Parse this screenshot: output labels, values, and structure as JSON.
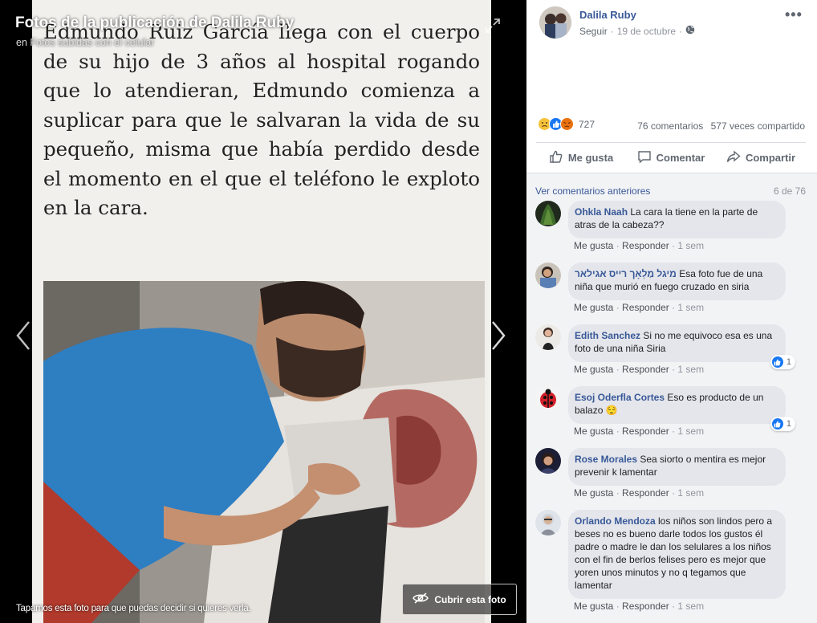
{
  "viewer": {
    "title": "Fotos de la publicación de Dalila Ruby",
    "subtitle": "en Fotos subidas con el celular",
    "photo_text": "Edmundo Ruiz García llega con el cuerpo de su hijo de 3 años al hospital rogando que lo atendieran, Edmundo comienza a suplicar para que le salvaran la vida de su pequeño, misma que había perdido desde el momento en el que el teléfono le exploto en la cara.",
    "caption": "Tapamos esta foto para que puedas decidir si quieres verla.",
    "cover_button_label": "Cubrir esta foto",
    "icons": {
      "expand": "expand-icon",
      "prev": "chevron-left-icon",
      "next": "chevron-right-icon",
      "cover": "eye-slash-icon"
    }
  },
  "post": {
    "author": "Dalila Ruby",
    "follow_label": "Seguir",
    "date": "19 de octubre",
    "privacy_icon": "globe-icon",
    "reaction_count": "727",
    "comments_count": "76 comentarios",
    "shares_count": "577 veces compartido",
    "actions": {
      "like": "Me gusta",
      "comment": "Comentar",
      "share": "Compartir"
    }
  },
  "comments_section": {
    "previous_link": "Ver comentarios anteriores",
    "count_label": "6 de 76",
    "action_like": "Me gusta",
    "action_reply": "Responder",
    "items": [
      {
        "name": "Ohkla Naah",
        "text": "La cara la tiene en la parte de atras de la cabeza??",
        "time": "1 sem",
        "likes": ""
      },
      {
        "name": "מיגל מַלְאָך רייס אגילאר",
        "text": "Esa foto fue de una niña que murió en fuego cruzado en siria",
        "time": "1 sem",
        "likes": ""
      },
      {
        "name": "Edith Sanchez",
        "text": "Si no me equivoco esa es una foto de una niña Siria",
        "time": "1 sem",
        "likes": "1"
      },
      {
        "name": "Esoj Oderfla Cortes",
        "text": "Eso es producto de un balazo 😌",
        "time": "1 sem",
        "likes": "1"
      },
      {
        "name": "Rose Morales",
        "text": "Sea siorto o mentira es mejor prevenir k lamentar",
        "time": "1 sem",
        "likes": ""
      },
      {
        "name": "Orlando Mendoza",
        "text": "los niños son lindos pero a beses no es bueno darle todos los gustos él padre o madre le dan los selulares a los niños con el fin de berlos felises pero es mejor que yoren unos minutos y no q tegamos que lamentar",
        "time": "1 sem",
        "likes": ""
      }
    ]
  },
  "colors": {
    "link": "#385898",
    "like_blue": "#1877f2",
    "viewer_bg": "#000000"
  }
}
